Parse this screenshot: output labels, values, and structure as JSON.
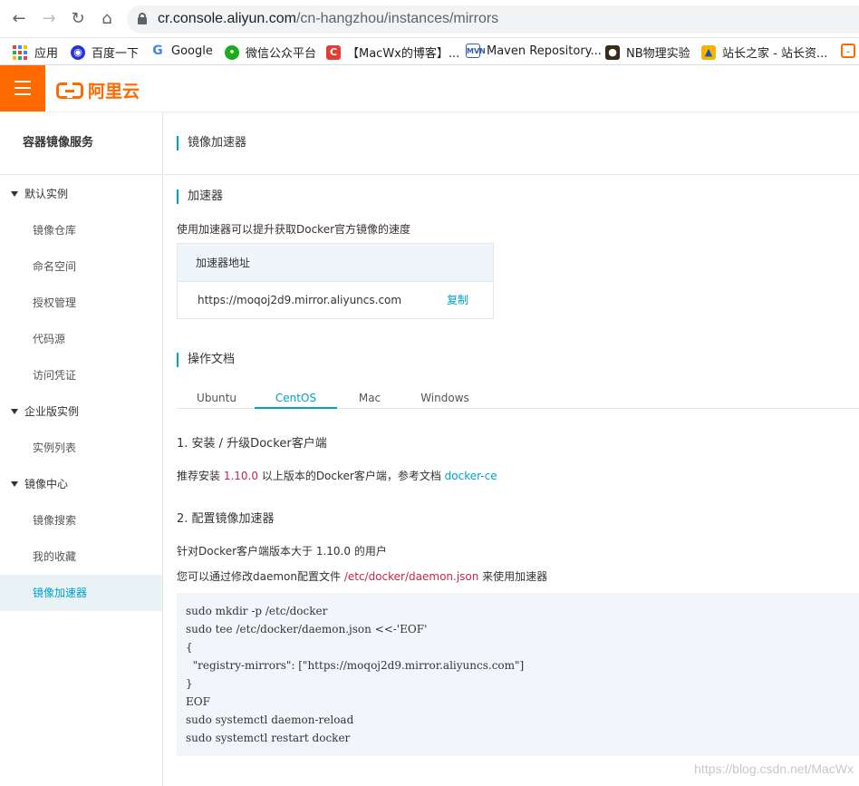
{
  "browser": {
    "url_host": "cr.console.aliyun.com",
    "url_path": "/cn-hangzhou/instances/mirrors",
    "bookmarks": [
      {
        "label": "应用",
        "icon": "apps-icon"
      },
      {
        "label": "百度一下",
        "icon": "baidu-paw-icon"
      },
      {
        "label": "Google",
        "icon": "google-icon"
      },
      {
        "label": "微信公众平台",
        "icon": "wechat-icon"
      },
      {
        "label": "【MacWx的博客】...",
        "icon": "csdn-icon"
      },
      {
        "label": "Maven Repository...",
        "icon": "maven-icon"
      },
      {
        "label": "NB物理实验",
        "icon": "nb-icon"
      },
      {
        "label": "站长之家 - 站长资...",
        "icon": "chinaz-icon"
      }
    ]
  },
  "header": {
    "logo_text": "阿里云"
  },
  "sidebar": {
    "title": "容器镜像服务",
    "groups": [
      {
        "label": "默认实例",
        "items": [
          "镜像仓库",
          "命名空间",
          "授权管理",
          "代码源",
          "访问凭证"
        ]
      },
      {
        "label": "企业版实例",
        "items": [
          "实例列表"
        ]
      },
      {
        "label": "镜像中心",
        "items": [
          "镜像搜索",
          "我的收藏",
          "镜像加速器"
        ]
      }
    ]
  },
  "main": {
    "page_title": "镜像加速器",
    "accelerator_title": "加速器",
    "accelerator_desc": "使用加速器可以提升获取Docker官方镜像的速度",
    "address_header": "加速器地址",
    "address": "https://moqoj2d9.mirror.aliyuncs.com",
    "copy_label": "复制",
    "docs_title": "操作文档",
    "tabs": [
      "Ubuntu",
      "CentOS",
      "Mac",
      "Windows"
    ],
    "active_tab": "CentOS",
    "step1_title": "1. 安装 / 升级Docker客户端",
    "step1_pre": "推荐安装 ",
    "step1_version": "1.10.0",
    "step1_mid": " 以上版本的Docker客户端，参考文档 ",
    "step1_link": "docker-ce",
    "step2_title": "2. 配置镜像加速器",
    "step2_line1": "针对Docker客户端版本大于 1.10.0 的用户",
    "step2_line2_pre": "您可以通过修改daemon配置文件 ",
    "step2_path": "/etc/docker/daemon.json",
    "step2_line2_post": " 来使用加速器",
    "code": [
      "sudo mkdir -p /etc/docker",
      "sudo tee /etc/docker/daemon.json <<-'EOF'",
      "{",
      "  \"registry-mirrors\": [\"https://moqoj2d9.mirror.aliyuncs.com\"]",
      "}",
      "EOF",
      "sudo systemctl daemon-reload",
      "sudo systemctl restart docker"
    ]
  },
  "watermark": "https://blog.csdn.net/MacWx",
  "colors": {
    "accent": "#00a2ca",
    "brand": "#ff6a00",
    "code_bg": "#f2f6fb",
    "highlight": "#c7254e"
  }
}
